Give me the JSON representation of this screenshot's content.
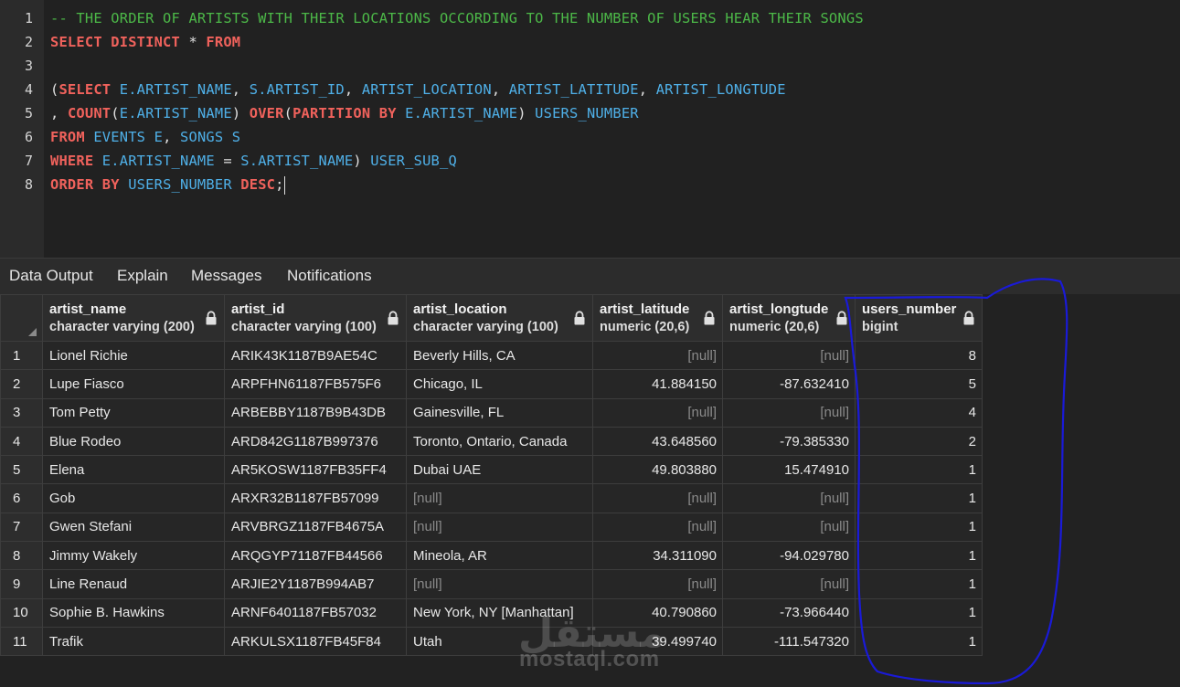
{
  "editor": {
    "line_numbers": [
      "1",
      "2",
      "3",
      "4",
      "5",
      "6",
      "7",
      "8"
    ],
    "lines": [
      [
        {
          "t": "-- THE ORDER OF ARTISTS WITH THEIR LOCATIONS OCCORDING TO THE NUMBER OF USERS HEAR THEIR SONGS",
          "c": "comment"
        }
      ],
      [
        {
          "t": "SELECT",
          "c": "kw"
        },
        {
          "t": " ",
          "c": "op"
        },
        {
          "t": "DISTINCT",
          "c": "kw"
        },
        {
          "t": " * ",
          "c": "op"
        },
        {
          "t": "FROM",
          "c": "kw"
        }
      ],
      [],
      [
        {
          "t": "(",
          "c": "op"
        },
        {
          "t": "SELECT",
          "c": "kw"
        },
        {
          "t": " E.ARTIST_NAME",
          "c": "id"
        },
        {
          "t": ", ",
          "c": "op"
        },
        {
          "t": "S.ARTIST_ID",
          "c": "id"
        },
        {
          "t": ", ",
          "c": "op"
        },
        {
          "t": "ARTIST_LOCATION",
          "c": "id"
        },
        {
          "t": ", ",
          "c": "op"
        },
        {
          "t": "ARTIST_LATITUDE",
          "c": "id"
        },
        {
          "t": ", ",
          "c": "op"
        },
        {
          "t": "ARTIST_LONGTUDE",
          "c": "id"
        }
      ],
      [
        {
          "t": ", ",
          "c": "op"
        },
        {
          "t": "COUNT",
          "c": "kw"
        },
        {
          "t": "(",
          "c": "op"
        },
        {
          "t": "E.ARTIST_NAME",
          "c": "id"
        },
        {
          "t": ") ",
          "c": "op"
        },
        {
          "t": "OVER",
          "c": "kw"
        },
        {
          "t": "(",
          "c": "op"
        },
        {
          "t": "PARTITION BY",
          "c": "kw"
        },
        {
          "t": " E.ARTIST_NAME",
          "c": "id"
        },
        {
          "t": ") ",
          "c": "op"
        },
        {
          "t": "USERS_NUMBER",
          "c": "id"
        }
      ],
      [
        {
          "t": "FROM",
          "c": "kw"
        },
        {
          "t": " EVENTS E",
          "c": "id"
        },
        {
          "t": ", ",
          "c": "op"
        },
        {
          "t": "SONGS S",
          "c": "id"
        }
      ],
      [
        {
          "t": "WHERE",
          "c": "kw"
        },
        {
          "t": " E.ARTIST_NAME",
          "c": "id"
        },
        {
          "t": " = ",
          "c": "op"
        },
        {
          "t": "S.ARTIST_NAME",
          "c": "id"
        },
        {
          "t": ") ",
          "c": "op"
        },
        {
          "t": "USER_SUB_Q",
          "c": "id"
        }
      ],
      [
        {
          "t": "ORDER BY",
          "c": "kw"
        },
        {
          "t": " USERS_NUMBER",
          "c": "id"
        },
        {
          "t": " ",
          "c": "op"
        },
        {
          "t": "DESC",
          "c": "kw"
        },
        {
          "t": ";",
          "c": "op"
        }
      ]
    ],
    "colors": {
      "comment": "#4cb848",
      "keyword": "#f0625c",
      "identifier": "#4fb0e8"
    }
  },
  "tabs": [
    {
      "label": "Data Output",
      "active": true
    },
    {
      "label": "Explain",
      "active": false
    },
    {
      "label": "Messages",
      "active": false
    },
    {
      "label": "Notifications",
      "active": false
    }
  ],
  "grid": {
    "columns": [
      {
        "name": "artist_name",
        "type": "character varying (200)",
        "icon": "lock-icon"
      },
      {
        "name": "artist_id",
        "type": "character varying (100)",
        "icon": "lock-icon"
      },
      {
        "name": "artist_location",
        "type": "character varying (100)",
        "icon": "lock-icon"
      },
      {
        "name": "artist_latitude",
        "type": "numeric (20,6)",
        "icon": "lock-icon"
      },
      {
        "name": "artist_longtude",
        "type": "numeric (20,6)",
        "icon": "lock-icon"
      },
      {
        "name": "users_number",
        "type": "bigint",
        "icon": "lock-icon"
      }
    ],
    "rows": [
      [
        "1",
        "Lionel Richie",
        "ARIK43K1187B9AE54C",
        "Beverly Hills, CA",
        "[null]",
        "[null]",
        "8"
      ],
      [
        "2",
        "Lupe Fiasco",
        "ARPFHN61187FB575F6",
        "Chicago, IL",
        "41.884150",
        "-87.632410",
        "5"
      ],
      [
        "3",
        "Tom Petty",
        "ARBEBBY1187B9B43DB",
        "Gainesville, FL",
        "[null]",
        "[null]",
        "4"
      ],
      [
        "4",
        "Blue Rodeo",
        "ARD842G1187B997376",
        "Toronto, Ontario, Canada",
        "43.648560",
        "-79.385330",
        "2"
      ],
      [
        "5",
        "Elena",
        "AR5KOSW1187FB35FF4",
        "Dubai UAE",
        "49.803880",
        "15.474910",
        "1"
      ],
      [
        "6",
        "Gob",
        "ARXR32B1187FB57099",
        "[null]",
        "[null]",
        "[null]",
        "1"
      ],
      [
        "7",
        "Gwen Stefani",
        "ARVBRGZ1187FB4675A",
        "[null]",
        "[null]",
        "[null]",
        "1"
      ],
      [
        "8",
        "Jimmy Wakely",
        "ARQGYP71187FB44566",
        "Mineola, AR",
        "34.311090",
        "-94.029780",
        "1"
      ],
      [
        "9",
        "Line Renaud",
        "ARJIE2Y1187B994AB7",
        "[null]",
        "[null]",
        "[null]",
        "1"
      ],
      [
        "10",
        "Sophie B. Hawkins",
        "ARNF6401187FB57032",
        "New York, NY [Manhattan]",
        "40.790860",
        "-73.966440",
        "1"
      ],
      [
        "11",
        "Trafik",
        "ARKULSX1187FB45F84",
        "Utah",
        "39.499740",
        "-111.547320",
        "1"
      ]
    ]
  },
  "watermark": {
    "arabic": "مستقل",
    "latin": "mostaql.com"
  },
  "annotation_color": "#1a1ad8"
}
